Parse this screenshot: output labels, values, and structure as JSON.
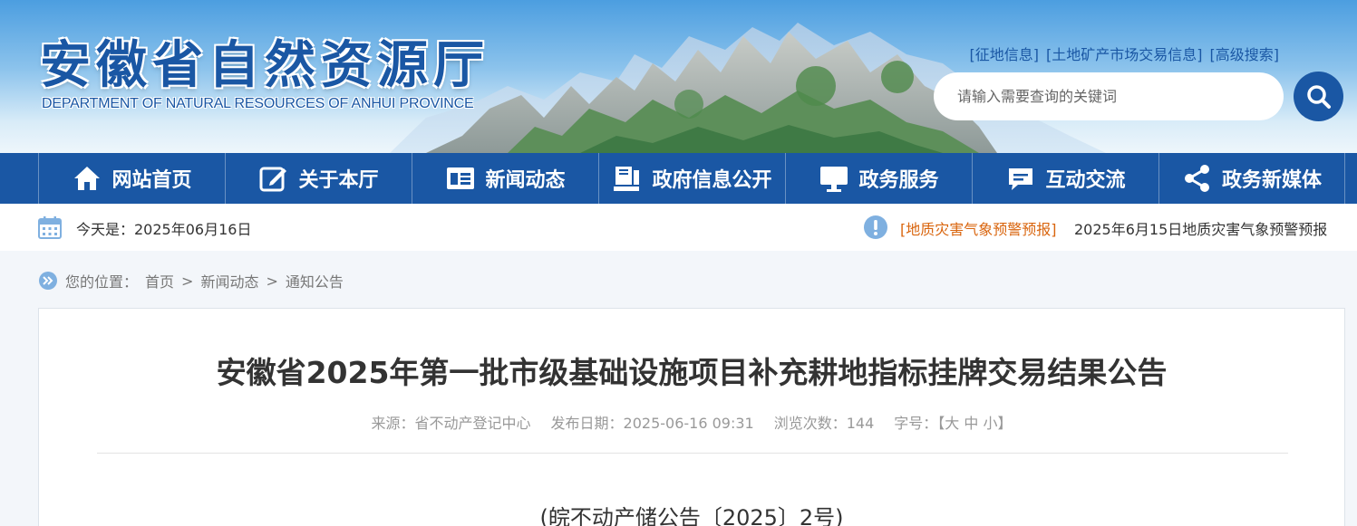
{
  "header": {
    "logo_cn": "安徽省自然资源厅",
    "logo_en": "DEPARTMENT OF NATURAL RESOURCES OF ANHUI PROVINCE",
    "top_links": [
      "[征地信息]",
      "[土地矿产市场交易信息]",
      "[高级搜索]"
    ],
    "search_placeholder": "请输入需要查询的关键词"
  },
  "nav": {
    "items": [
      {
        "label": "网站首页",
        "icon": "home-icon"
      },
      {
        "label": "关于本厅",
        "icon": "edit-icon"
      },
      {
        "label": "新闻动态",
        "icon": "news-icon"
      },
      {
        "label": "政府信息公开",
        "icon": "book-icon"
      },
      {
        "label": "政务服务",
        "icon": "monitor-icon"
      },
      {
        "label": "互动交流",
        "icon": "chat-icon"
      },
      {
        "label": "政务新媒体",
        "icon": "share-icon"
      }
    ]
  },
  "datebar": {
    "today": "今天是：2025年06月16日",
    "warning_tag": "[地质灾害气象预警预报]",
    "warning_text": "2025年6月15日地质灾害气象预警预报"
  },
  "breadcrumb": {
    "prefix": "您的位置：",
    "items": [
      "首页",
      "新闻动态",
      "通知公告"
    ],
    "separator": ">"
  },
  "article": {
    "title": "安徽省2025年第一批市级基础设施项目补充耕地指标挂牌交易结果公告",
    "source": "来源：省不动产登记中心",
    "date": "发布日期：2025-06-16 09:31",
    "views": "浏览次数：144",
    "font_size_label": "字号：【大 中 小】",
    "doc_number": "(皖不动产储公告〔2025〕2号)"
  },
  "colors": {
    "primary": "#1a57a4",
    "warning": "#d9650e",
    "icon_blue": "#7fb0e0"
  }
}
